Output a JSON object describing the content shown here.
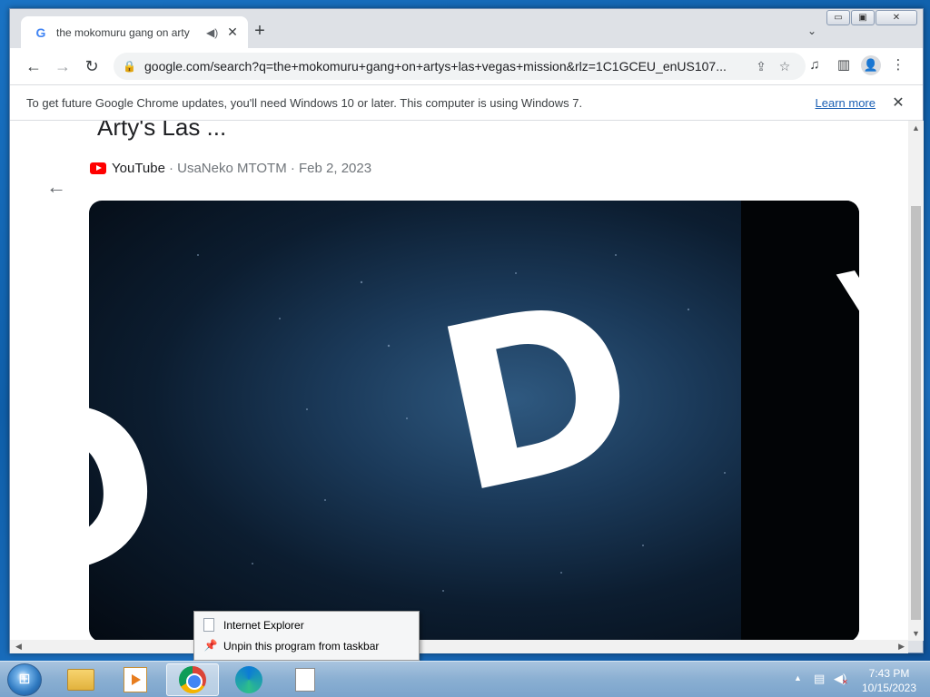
{
  "window": {
    "tab_title": "the mokomuru gang on arty",
    "new_tab": "+",
    "tab_close": "✕",
    "minimize": "▭",
    "restore": "▣",
    "close": "✕"
  },
  "toolbar": {
    "url": "google.com/search?q=the+mokomuru+gang+on+artys+las+vegas+mission&rlz=1C1GCEU_enUS107..."
  },
  "infobar": {
    "message": "To get future Google Chrome updates, you'll need Windows 10 or later. This computer is using Windows 7.",
    "learn_more": "Learn more",
    "dismiss": "✕"
  },
  "result": {
    "title": "Arty's Las ...",
    "source": "YouTube",
    "meta": "· UsaNeko MTOTM · Feb 2, 2023",
    "video_letters": [
      "D",
      "D",
      "V"
    ]
  },
  "context_menu": {
    "items": [
      {
        "label": "Internet Explorer",
        "icon": "page-icon"
      },
      {
        "label": "Unpin this program from taskbar",
        "icon": "pin-icon"
      }
    ]
  },
  "taskbar": {
    "time": "7:43 PM",
    "date": "10/15/2023",
    "apps": [
      "windows-explorer",
      "media-player",
      "chrome",
      "edge",
      "blank-window"
    ]
  },
  "colors": {
    "youtube_red": "#ff0000",
    "link_blue": "#1a5fb4",
    "taskbar": "#8aafd2"
  }
}
